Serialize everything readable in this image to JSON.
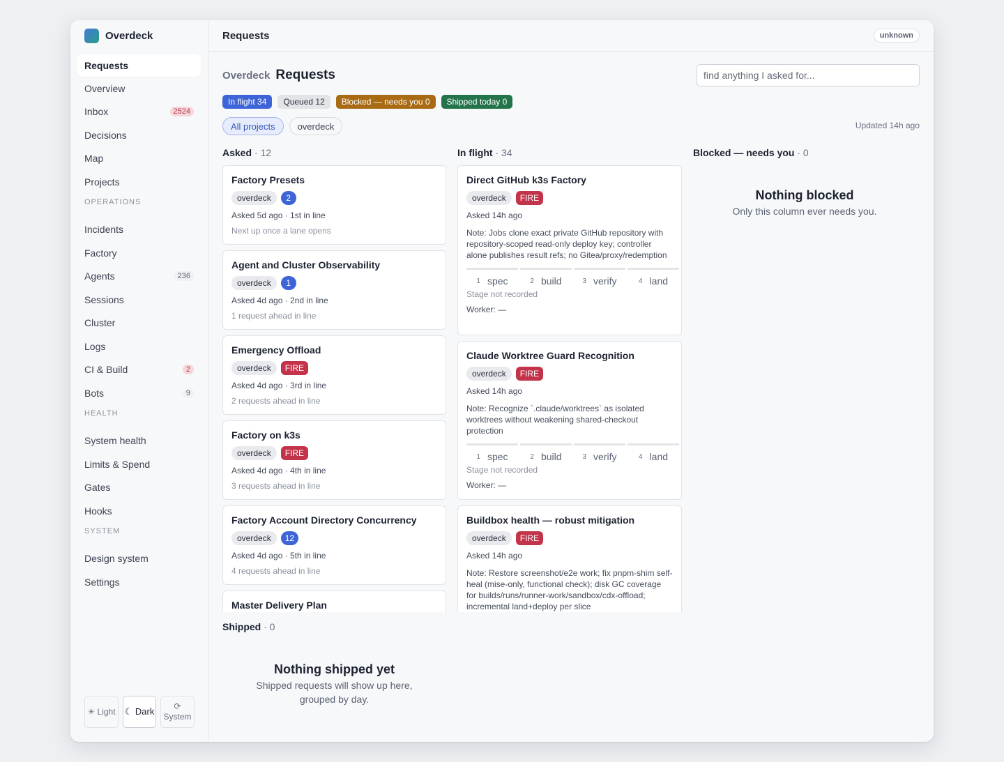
{
  "brand": "Overdeck",
  "topbar": {
    "title": "Requests",
    "status": "unknown"
  },
  "nav": [
    {
      "label": "Requests",
      "active": true
    },
    {
      "label": "Overview"
    },
    {
      "label": "Inbox",
      "badge": "2524",
      "badge_style": "red"
    },
    {
      "label": "Decisions"
    },
    {
      "label": "Map"
    },
    {
      "label": "Projects"
    },
    {
      "section": "OPERATIONS"
    },
    {
      "label": "Incidents"
    },
    {
      "label": "Factory"
    },
    {
      "label": "Agents",
      "badge": "236",
      "badge_style": "gray"
    },
    {
      "label": "Sessions"
    },
    {
      "label": "Cluster"
    },
    {
      "label": "Logs"
    },
    {
      "label": "CI & Build",
      "badge": "2",
      "badge_style": "red"
    },
    {
      "label": "Bots",
      "badge": "9",
      "badge_style": "gray"
    },
    {
      "section": "HEALTH"
    },
    {
      "label": "System health"
    },
    {
      "label": "Limits & Spend"
    },
    {
      "label": "Gates"
    },
    {
      "label": "Hooks"
    },
    {
      "section": "SYSTEM"
    },
    {
      "label": "Design system"
    },
    {
      "label": "Settings"
    }
  ],
  "theme": {
    "light": "☀ Light",
    "dark": "☾ Dark",
    "system_icon": "⟳",
    "system": "System"
  },
  "header": {
    "crumb": "Overdeck",
    "title": "Requests"
  },
  "search": {
    "placeholder": "find anything I asked for...",
    "value": ""
  },
  "summary": [
    {
      "label": "In flight 34",
      "color": "#3e65d8",
      "text": "#ffffff"
    },
    {
      "label": "Queued 12",
      "color": "#e2e4e8",
      "text": "#2a303c"
    },
    {
      "label": "Blocked — needs you 0",
      "color": "#a86a12",
      "text": "#ffffff"
    },
    {
      "label": "Shipped today 0",
      "color": "#23744a",
      "text": "#ffffff"
    }
  ],
  "filters": [
    {
      "label": "All projects",
      "active": true
    },
    {
      "label": "overdeck"
    }
  ],
  "updated": "Updated 14h ago",
  "columns": {
    "asked": {
      "title": "Asked",
      "count": "· 12"
    },
    "inflight": {
      "title": "In flight",
      "count": "· 34"
    },
    "blocked": {
      "title": "Blocked — needs you",
      "count": "· 0",
      "empty_title": "Nothing blocked",
      "empty_sub": "Only this column ever needs you."
    },
    "shipped": {
      "title": "Shipped",
      "count": "· 0",
      "empty_title": "Nothing shipped yet",
      "empty_sub": "Shipped requests will show up here, grouped by day."
    }
  },
  "asked_cards": [
    {
      "title": "Factory Presets",
      "tag": "overdeck",
      "pill": "2",
      "pill_type": "num",
      "meta": "Asked 5d ago · 1st in line",
      "sub": "Next up once a lane opens"
    },
    {
      "title": "Agent and Cluster Observability",
      "tag": "overdeck",
      "pill": "1",
      "pill_type": "num",
      "meta": "Asked 4d ago · 2nd in line",
      "sub": "1 request ahead in line"
    },
    {
      "title": "Emergency Offload",
      "tag": "overdeck",
      "pill": "FIRE",
      "pill_type": "fire",
      "meta": "Asked 4d ago · 3rd in line",
      "sub": "2 requests ahead in line"
    },
    {
      "title": "Factory on k3s",
      "tag": "overdeck",
      "pill": "FIRE",
      "pill_type": "fire",
      "meta": "Asked 4d ago · 4th in line",
      "sub": "3 requests ahead in line"
    },
    {
      "title": "Factory Account Directory Concurrency",
      "tag": "overdeck",
      "pill": "12",
      "pill_type": "num",
      "meta": "Asked 4d ago · 5th in line",
      "sub": "4 requests ahead in line"
    },
    {
      "title": "Master Delivery Plan",
      "tag": "",
      "pill": "",
      "pill_type": "",
      "meta": "",
      "sub": ""
    }
  ],
  "inflight_cards": [
    {
      "title": "Direct GitHub k3s Factory",
      "tag": "overdeck",
      "pill": "FIRE",
      "meta": "Asked 14h ago",
      "note": "Note: Jobs clone exact private GitHub repository with repository-scoped read-only deploy key; controller alone publishes result refs; no Gitea/proxy/redemption",
      "stage": "Stage not recorded",
      "worker": "Worker: —"
    },
    {
      "title": "Claude Worktree Guard Recognition",
      "tag": "overdeck",
      "pill": "FIRE",
      "meta": "Asked 14h ago",
      "note": "Note: Recognize `.claude/worktrees` as isolated worktrees without weakening shared-checkout protection",
      "stage": "Stage not recorded",
      "worker": "Worker: —"
    },
    {
      "title": "Buildbox health — robust mitigation",
      "tag": "overdeck",
      "pill": "FIRE",
      "meta": "Asked 14h ago",
      "note": "Note: Restore screenshot/e2e work; fix pnpm-shim self-heal (mise-only, functional check); disk GC coverage for builds/runs/runner-work/sandbox/cdx-offload; incremental land+deploy per slice",
      "stage": "",
      "worker": ""
    }
  ],
  "stages": [
    {
      "n": "1",
      "label": "spec"
    },
    {
      "n": "2",
      "label": "build"
    },
    {
      "n": "3",
      "label": "verify"
    },
    {
      "n": "4",
      "label": "land"
    }
  ]
}
